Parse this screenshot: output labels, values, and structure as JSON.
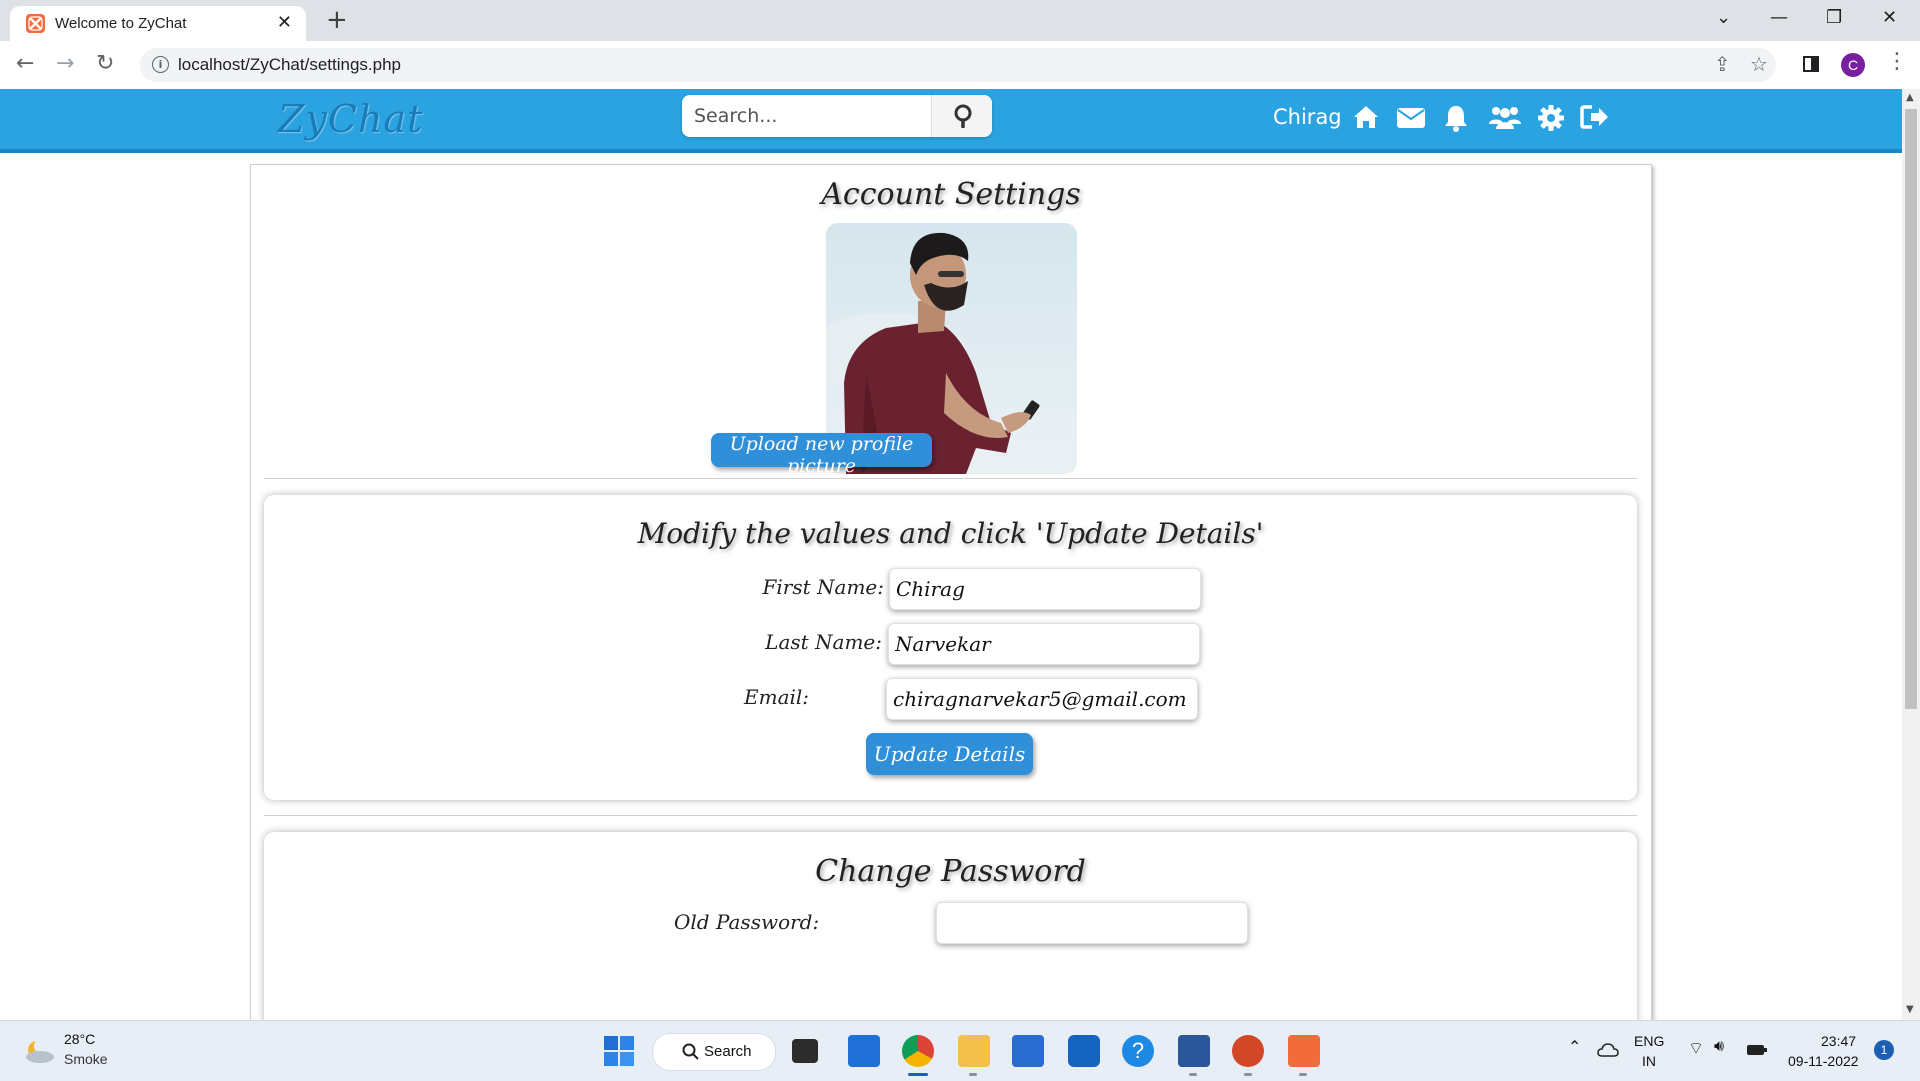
{
  "browser": {
    "tab_title": "Welcome to ZyChat",
    "url": "localhost/ZyChat/settings.php",
    "profile_initial": "C"
  },
  "site": {
    "logo": "ZyChat",
    "search_placeholder": "Search...",
    "username": "Chirag",
    "nav_icons": [
      "home-icon",
      "mail-icon",
      "bell-icon",
      "users-icon",
      "gear-icon",
      "logout-icon"
    ],
    "header_color": "#2ba3e0"
  },
  "settings": {
    "title": "Account Settings",
    "upload_button": "Upload new profile picture",
    "details": {
      "title": "Modify the values and click 'Update Details'",
      "first_name_label": "First Name:",
      "first_name_value": "Chirag",
      "last_name_label": "Last Name:",
      "last_name_value": "Narvekar",
      "email_label": "Email:",
      "email_value": "chiragnarvekar5@gmail.com",
      "update_button": "Update Details"
    },
    "password": {
      "title": "Change Password",
      "old_password_label": "Old Password:"
    }
  },
  "taskbar": {
    "weather_temp": "28°C",
    "weather_desc": "Smoke",
    "search_label": "Search",
    "lang_top": "ENG",
    "lang_bottom": "IN",
    "time": "23:47",
    "date": "09-11-2022",
    "notification_count": "1"
  }
}
